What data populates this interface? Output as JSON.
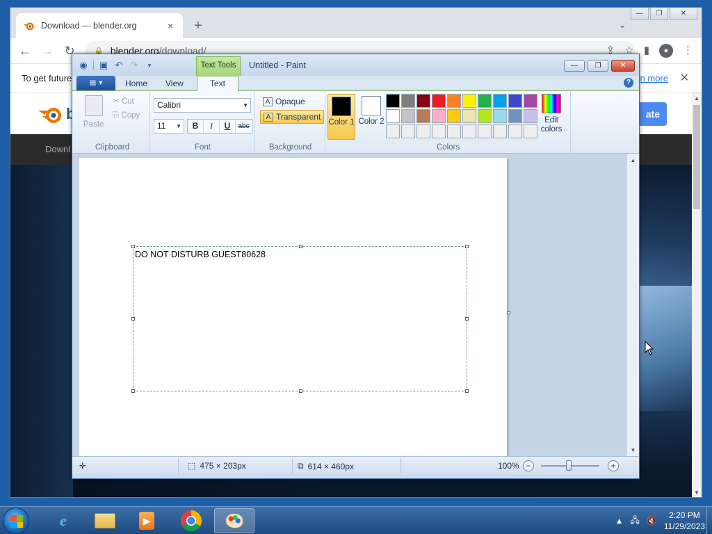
{
  "browser": {
    "tab_title": "Download — blender.org",
    "tab_close": "×",
    "new_tab": "+",
    "tab_dropdown": "⌄",
    "url_domain": "blender.org",
    "url_path": "/download/",
    "infobar_message": "To get future",
    "infobar_link": "n more",
    "infobar_close": "✕",
    "site_logo_partial": "b",
    "donate_partial": "ate",
    "nav_partial": "Downl"
  },
  "paint": {
    "context_tab": "Text Tools",
    "title": "Untitled - Paint",
    "tabs": {
      "home": "Home",
      "view": "View",
      "text": "Text"
    },
    "clipboard": {
      "paste": "Paste",
      "cut": "Cut",
      "copy": "Copy",
      "label": "Clipboard"
    },
    "font": {
      "family": "Calibri",
      "size": "11",
      "bold": "B",
      "italic": "I",
      "underline": "U",
      "strike": "abc",
      "label": "Font"
    },
    "background": {
      "opaque": "Opaque",
      "transparent": "Transparent",
      "label": "Background"
    },
    "colors": {
      "color1_label": "Color 1",
      "color2_label": "Color 2",
      "color1": "#000000",
      "color2": "#ffffff",
      "edit_label": "Edit colors",
      "label": "Colors",
      "palette_row1": [
        "#000000",
        "#7f7f7f",
        "#880015",
        "#ed1c24",
        "#ff7f27",
        "#fff200",
        "#22b14c",
        "#00a2e8",
        "#3f48cc",
        "#a349a4"
      ],
      "palette_row2": [
        "#ffffff",
        "#c3c3c3",
        "#b97a57",
        "#ffaec9",
        "#ffc90e",
        "#efe4b0",
        "#b5e61d",
        "#99d9ea",
        "#7092be",
        "#c8bfe7"
      ],
      "palette_row3": [
        "#eeeeee",
        "#eeeeee",
        "#eeeeee",
        "#eeeeee",
        "#eeeeee",
        "#eeeeee",
        "#eeeeee",
        "#eeeeee",
        "#eeeeee",
        "#eeeeee"
      ]
    },
    "canvas_text": "DO NOT DISTURB GUEST80628",
    "status": {
      "selection_size": "475 × 203px",
      "canvas_size": "614 × 460px",
      "zoom": "100%"
    }
  },
  "taskbar": {
    "time": "2:20 PM",
    "date": "11/29/2023"
  }
}
